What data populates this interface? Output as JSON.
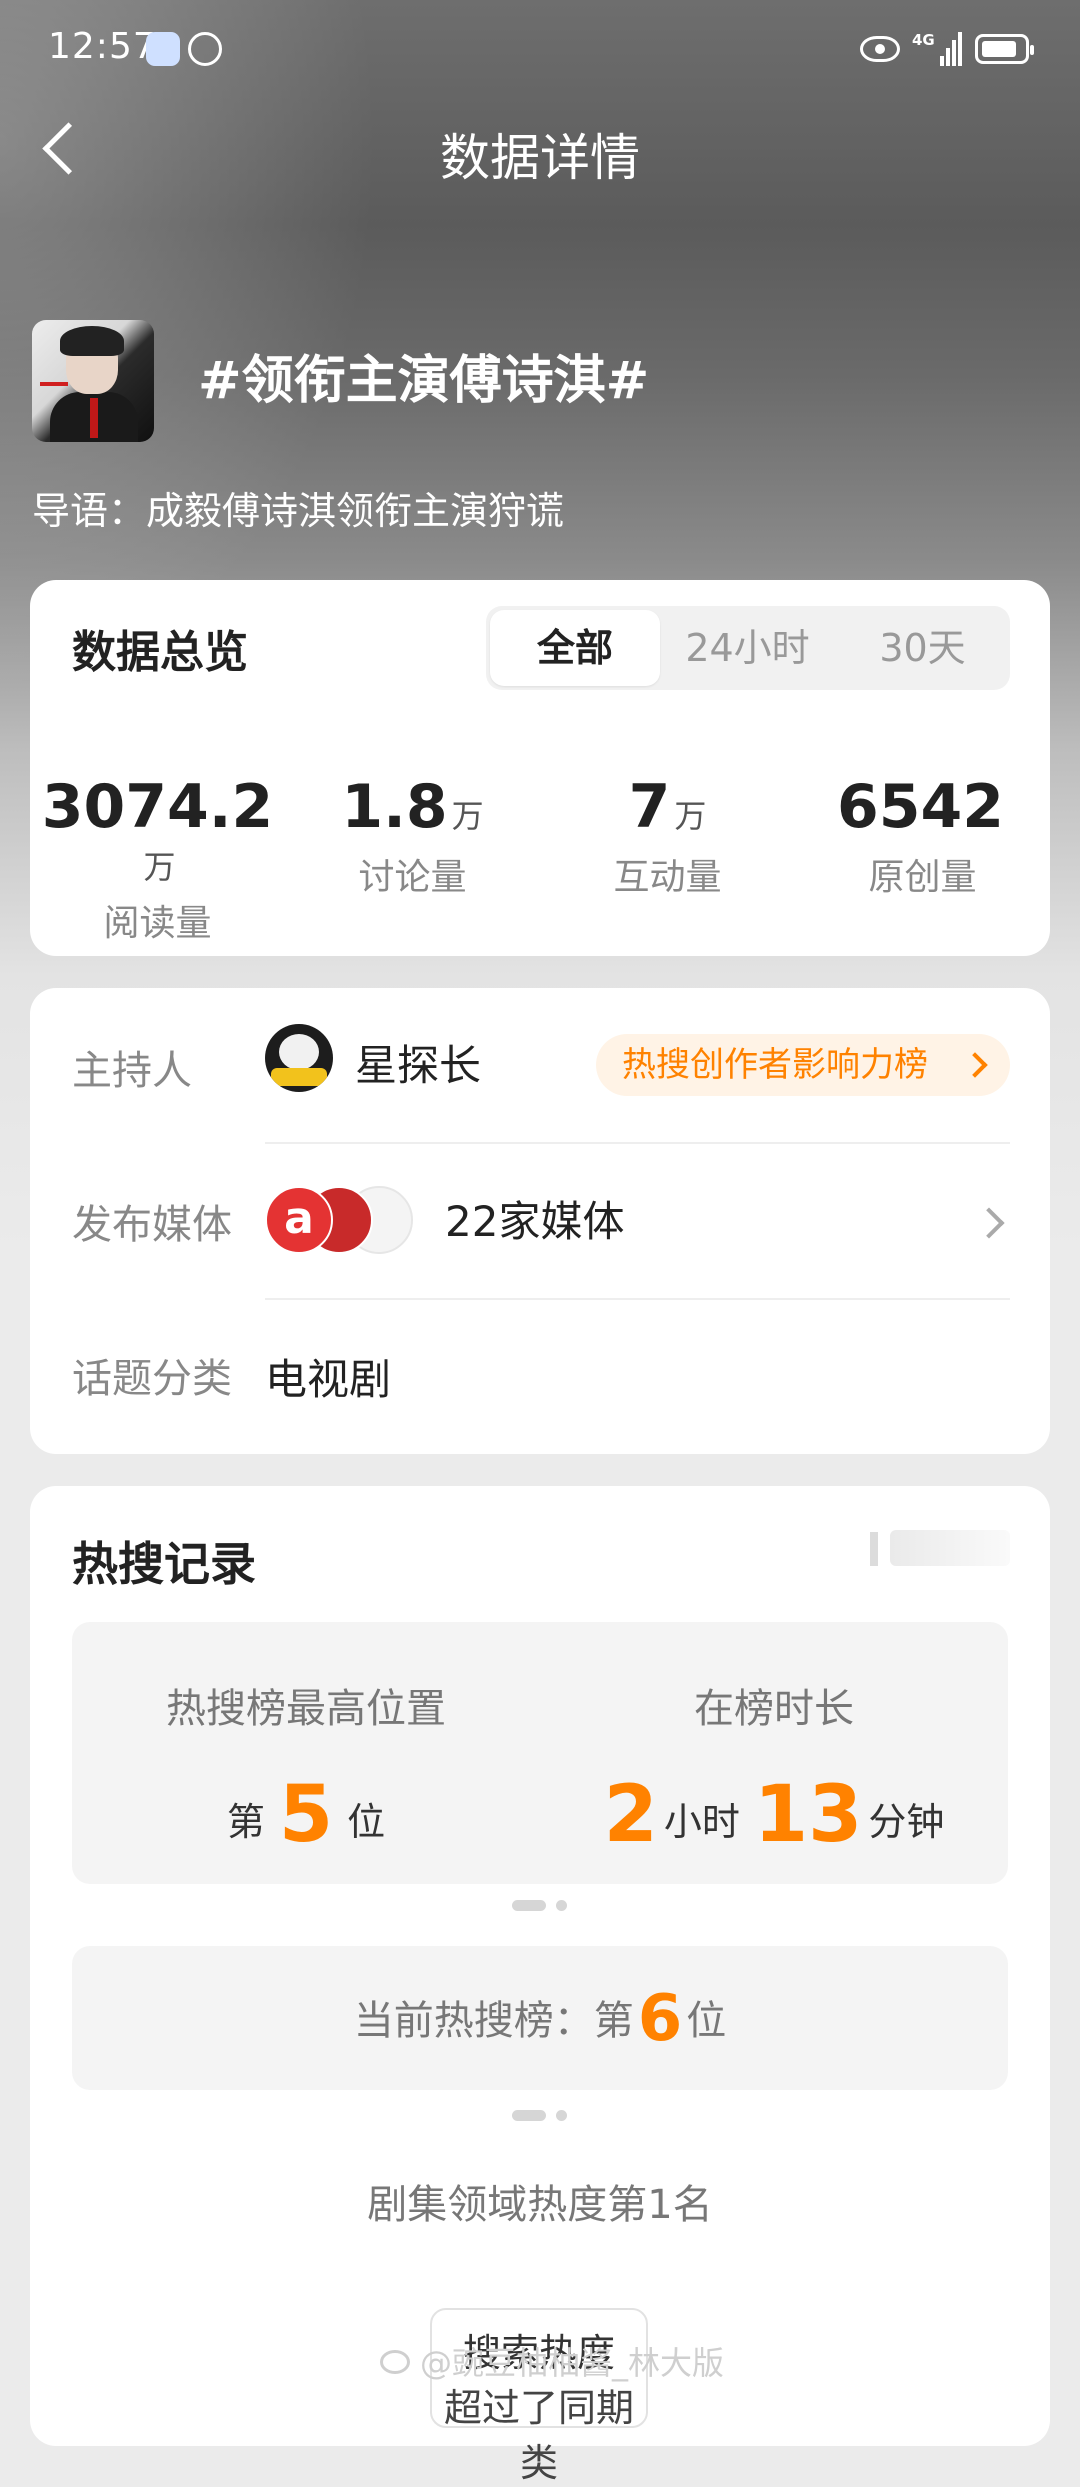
{
  "status_bar": {
    "time": "12:57",
    "network": "4G"
  },
  "nav": {
    "title": "数据详情"
  },
  "topic": {
    "title": "#领衔主演傅诗淇#",
    "intro": "导语：成毅傅诗淇领衔主演狩谎"
  },
  "overview": {
    "title": "数据总览",
    "tabs": [
      "全部",
      "24小时",
      "30天"
    ],
    "active_tab": "全部",
    "stats": [
      {
        "value": "3074.2",
        "unit": "万",
        "label": "阅读量"
      },
      {
        "value": "1.8",
        "unit": "万",
        "label": "讨论量"
      },
      {
        "value": "7",
        "unit": "万",
        "label": "互动量"
      },
      {
        "value": "6542",
        "unit": "",
        "label": "原创量"
      }
    ]
  },
  "info": {
    "host_label": "主持人",
    "host_name": "星探长",
    "rank_link": "热搜创作者影响力榜",
    "media_label": "发布媒体",
    "media_count": "22家媒体",
    "category_label": "话题分类",
    "category_value": "电视剧"
  },
  "hot_search": {
    "title": "热搜记录",
    "peak_label": "热搜榜最高位置",
    "peak_prefix": "第",
    "peak_value": "5",
    "peak_suffix": "位",
    "duration_label": "在榜时长",
    "duration_hours": "2",
    "hours_unit": "小时",
    "duration_minutes": "13",
    "minutes_unit": "分钟",
    "current_prefix": "当前热搜榜：第",
    "current_value": "6",
    "current_suffix": "位",
    "domain_rank": "剧集领域热度第1名",
    "search_button_line1": "搜索热度",
    "search_button_line2": "超过了同期类"
  },
  "watermark": "@豌豆柚柚酱_林大版",
  "colors": {
    "accent": "#ff8200",
    "card": "#ffffff"
  }
}
